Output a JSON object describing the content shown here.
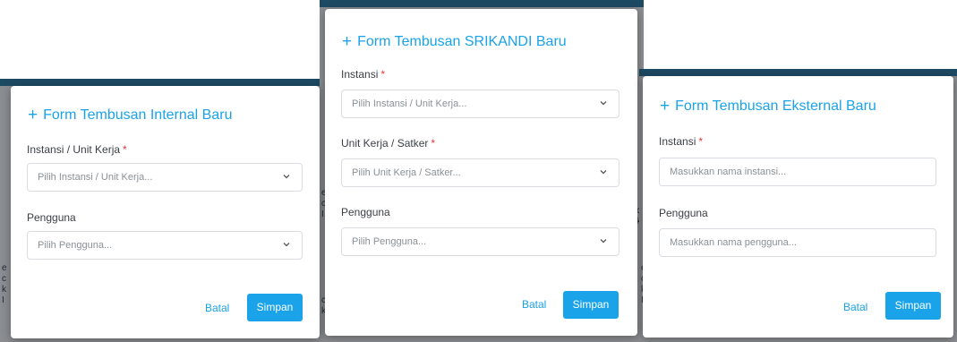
{
  "internal_form": {
    "title": "Form Tembusan Internal Baru",
    "plus": "+",
    "instansi_label": "Instansi / Unit Kerja",
    "required_mark": "*",
    "instansi_placeholder": "Pilih Instansi / Unit Kerja...",
    "pengguna_label": "Pengguna",
    "pengguna_placeholder": "Pilih Pengguna...",
    "cancel_label": "Batal",
    "save_label": "Simpan"
  },
  "srikandi_form": {
    "title": "Form Tembusan SRIKANDI Baru",
    "plus": "+",
    "instansi_label": "Instansi",
    "required_mark": "*",
    "instansi_placeholder": "Pilih Instansi / Unit Kerja...",
    "unit_label": "Unit Kerja / Satker",
    "unit_placeholder": "Pilih Unit Kerja / Satker...",
    "pengguna_label": "Pengguna",
    "pengguna_placeholder": "Pilih Pengguna...",
    "cancel_label": "Batal",
    "save_label": "Simpan"
  },
  "external_form": {
    "title": "Form Tembusan Eksternal Baru",
    "plus": "+",
    "instansi_label": "Instansi",
    "required_mark": "*",
    "instansi_placeholder": "Masukkan nama instansi...",
    "pengguna_label": "Pengguna",
    "pengguna_placeholder": "Masukkan nama pengguna...",
    "cancel_label": "Batal",
    "save_label": "Simpan"
  },
  "colors": {
    "accent": "#1aa3e8",
    "required": "#e53935",
    "header_bar": "#1d4a63",
    "backdrop": "#8a8d91"
  },
  "icons": {
    "chevron": "chevron-down-icon",
    "plus": "plus-icon"
  }
}
